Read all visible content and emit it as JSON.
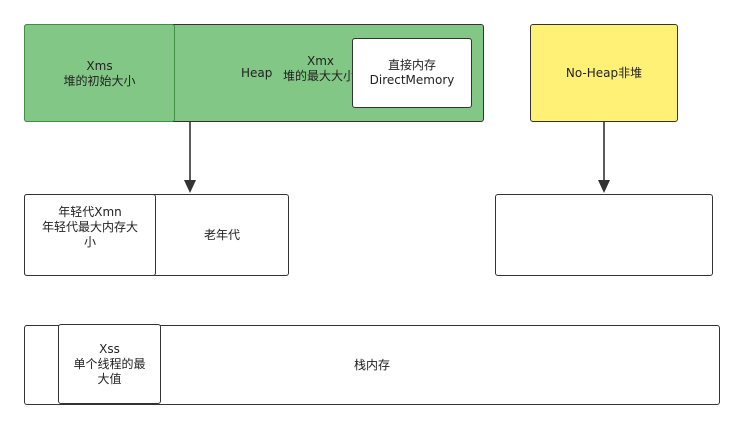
{
  "heap_region": {
    "xms_line1": "Xms",
    "xms_line2": "堆的初始大小",
    "heap_label": "Heap",
    "xmx_line1": "Xmx",
    "xmx_line2": "堆的最大大小",
    "direct_line1": "直接内存",
    "direct_line2": "DirectMemory"
  },
  "non_heap": {
    "label": "No-Heap非堆"
  },
  "young_old": {
    "young_line1": "年轻代Xmn",
    "young_line2": "年轻代最大内存大",
    "young_line3": "小",
    "old_label": "老年代"
  },
  "stack": {
    "xss_line1": "Xss",
    "xss_line2": "单个线程的最",
    "xss_line3": "大值",
    "stack_label": "栈内存"
  },
  "colors": {
    "heap_fill": "#82c785",
    "non_heap_fill": "#fff176",
    "stroke": "#333333"
  }
}
